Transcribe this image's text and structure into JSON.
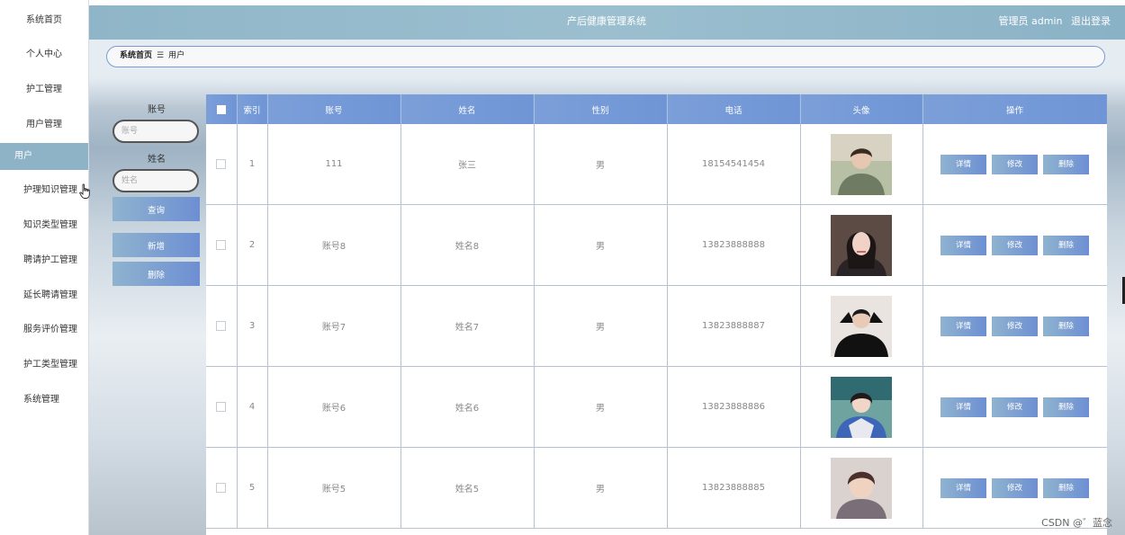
{
  "header": {
    "title": "产后健康管理系统",
    "user": "管理员 admin",
    "logout": "退出登录"
  },
  "sidebar": {
    "items": [
      {
        "label": "系统首页"
      },
      {
        "label": "个人中心"
      },
      {
        "label": "护工管理"
      },
      {
        "label": "用户管理"
      },
      {
        "label": "用户"
      },
      {
        "label": "护理知识管理"
      },
      {
        "label": "知识类型管理"
      },
      {
        "label": "聘请护工管理"
      },
      {
        "label": "延长聘请管理"
      },
      {
        "label": "服务评价管理"
      },
      {
        "label": "护工类型管理"
      },
      {
        "label": "系统管理"
      }
    ]
  },
  "breadcrumb": {
    "home": "系统首页",
    "separator": "☰",
    "current": "用户"
  },
  "search": {
    "account_label": "账号",
    "account_placeholder": "账号",
    "name_label": "姓名",
    "name_placeholder": "姓名",
    "query_button": "查询",
    "add_button": "新增",
    "delete_button": "删除"
  },
  "table": {
    "columns": [
      "索引",
      "账号",
      "姓名",
      "性别",
      "电话",
      "头像",
      "操作"
    ],
    "actions": {
      "detail": "详情",
      "edit": "修改",
      "delete": "删除"
    },
    "rows": [
      {
        "index": "1",
        "account": "111",
        "name": "张三",
        "gender": "男",
        "phone": "18154541454"
      },
      {
        "index": "2",
        "account": "账号8",
        "name": "姓名8",
        "gender": "男",
        "phone": "13823888888"
      },
      {
        "index": "3",
        "account": "账号7",
        "name": "姓名7",
        "gender": "男",
        "phone": "13823888887"
      },
      {
        "index": "4",
        "account": "账号6",
        "name": "姓名6",
        "gender": "男",
        "phone": "13823888886"
      },
      {
        "index": "5",
        "account": "账号5",
        "name": "姓名5",
        "gender": "男",
        "phone": "13823888885"
      }
    ]
  },
  "watermark": "CSDN @゛蓝念",
  "colors": {
    "accent": "#6f95d6",
    "header": "#8fb6c8",
    "active_menu": "#8fb3c6"
  }
}
